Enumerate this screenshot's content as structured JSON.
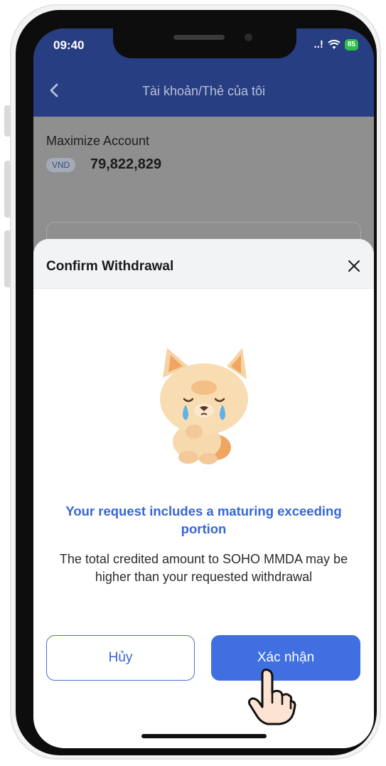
{
  "status_bar": {
    "time": "09:40",
    "signal": "..!",
    "battery": "85"
  },
  "header": {
    "title": "Tài khoản/Thẻ của tôi"
  },
  "account": {
    "name": "Maximize Account",
    "currency": "VND",
    "balance": "79,822,829"
  },
  "dialog": {
    "title": "Confirm Withdrawal",
    "headline": "Your request includes a maturing exceeding portion",
    "message": "The total credited amount to SOHO MMDA may be higher than your requested withdrawal",
    "cancel_label": "Hủy",
    "confirm_label": "Xác nhận"
  },
  "colors": {
    "brand_blue": "#3f6fe0",
    "header_dimmed": "#283e82",
    "accent_text": "#3566d6",
    "battery_green": "#2fbf4a"
  },
  "icons": [
    "back-icon",
    "close-icon",
    "wifi-icon",
    "battery-icon",
    "crying-cat-mascot",
    "tap-hand-icon"
  ]
}
